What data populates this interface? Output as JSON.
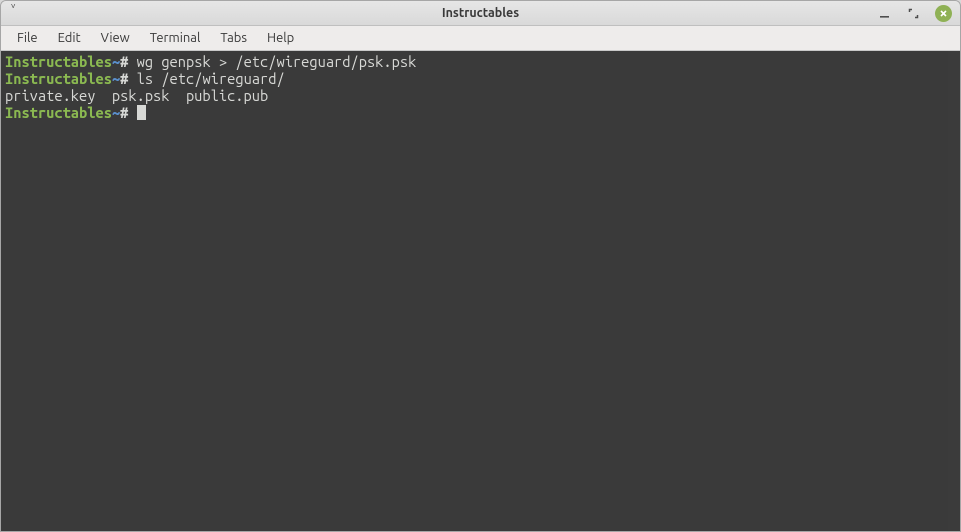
{
  "window": {
    "title": "Instructables"
  },
  "menus": {
    "file": "File",
    "edit": "Edit",
    "view": "View",
    "terminal": "Terminal",
    "tabs": "Tabs",
    "help": "Help"
  },
  "terminal": {
    "lines": [
      {
        "prompt_host": "Instructables",
        "prompt_path": "~",
        "prompt_symbol": "#",
        "command": "wg genpsk > /etc/wireguard/psk.psk"
      },
      {
        "prompt_host": "Instructables",
        "prompt_path": "~",
        "prompt_symbol": "#",
        "command": "ls /etc/wireguard/"
      }
    ],
    "output": "private.key  psk.psk  public.pub",
    "current_prompt": {
      "host": "Instructables",
      "path": "~",
      "symbol": "#"
    }
  }
}
